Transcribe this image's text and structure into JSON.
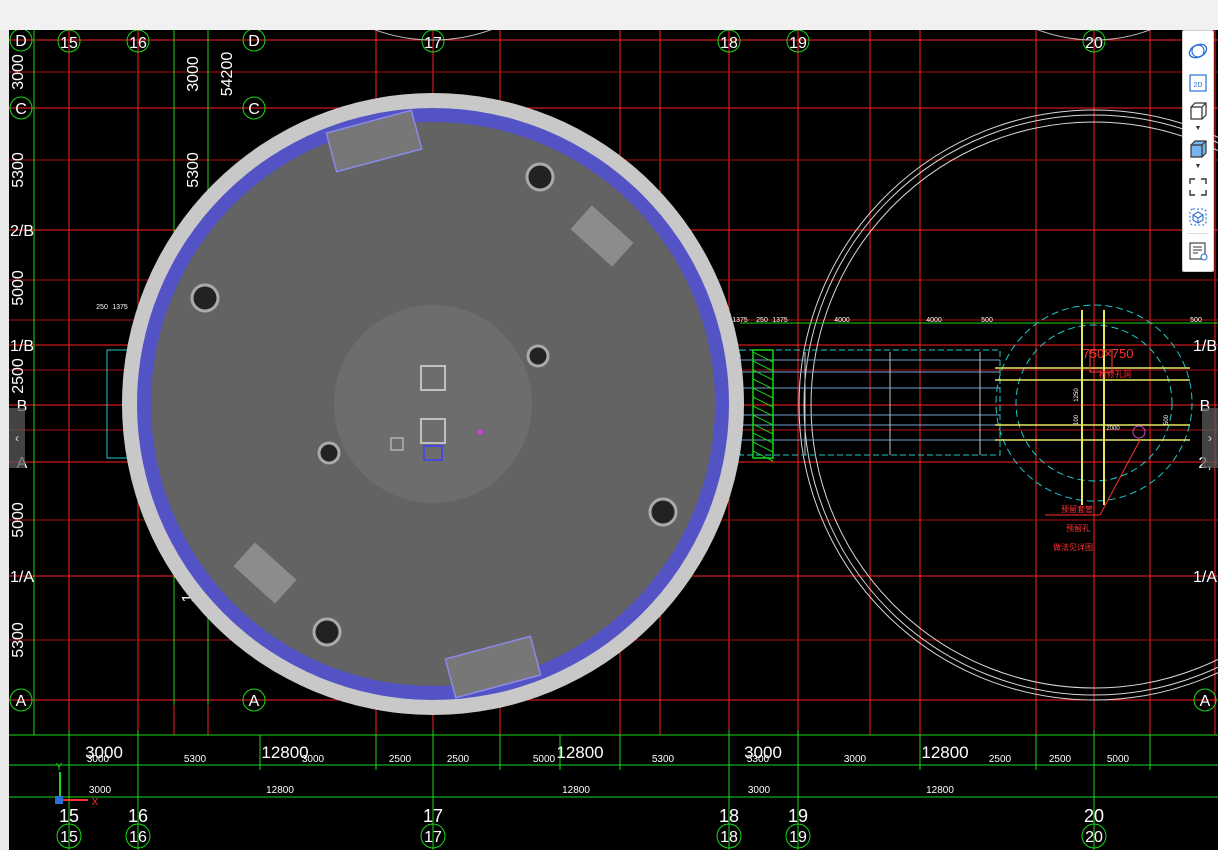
{
  "nav": {
    "prev": "‹",
    "next": "›"
  },
  "toolbar": [
    {
      "name": "orbit-icon",
      "label": "orbit"
    },
    {
      "name": "view-2d-icon",
      "label": "2D"
    },
    {
      "name": "wireframe-cube-icon",
      "label": "wireframe"
    },
    {
      "name": "shaded-cube-icon",
      "label": "shaded"
    },
    {
      "name": "zoom-extents-icon",
      "label": "extents"
    },
    {
      "name": "view-cube-icon",
      "label": "view"
    },
    {
      "name": "layers-list-icon",
      "label": "layers"
    }
  ],
  "grid": {
    "cols": [
      {
        "label": "15"
      },
      {
        "label": "16"
      },
      {
        "label": "17"
      },
      {
        "label": "18"
      },
      {
        "label": "19"
      },
      {
        "label": "20"
      }
    ],
    "rows_left": [
      "D",
      "C",
      "2/B",
      "1/B",
      "B",
      "A",
      "1/A",
      "A"
    ],
    "rows_right": [
      "1/B",
      "B",
      "2,",
      "1/A",
      "A"
    ],
    "inner_row_labels": [
      "D",
      "C",
      "A"
    ],
    "left_dims": [
      "3000",
      "5300",
      "5000",
      "2500",
      "5000",
      "5300"
    ],
    "inner_dims": [
      "3000",
      "5300",
      "54200"
    ],
    "inner_dim_partial": "1"
  },
  "bottom_dims": {
    "row1_big": [
      "3000",
      "12800",
      "12800",
      "3000",
      "12800"
    ],
    "row1_small": [
      "3000",
      "5300",
      "3000",
      "2500",
      "2500",
      "5000",
      "5300",
      "5300",
      "3000",
      "2500",
      "2500",
      "5000"
    ],
    "row2": [
      "3000",
      "12800",
      "12800",
      "3000",
      "12800"
    ]
  },
  "annotations": {
    "small_dims_left": [
      "250",
      "1375"
    ],
    "small_dims_right": [
      "1375",
      "250",
      "1375",
      "4000",
      "4000",
      "500",
      "500"
    ],
    "red_size": "750×750",
    "red_notes": [
      "检修孔洞",
      "预留套管",
      "预留孔",
      "做法见详图"
    ],
    "small_nums": [
      "1250",
      "2000",
      "100",
      "500"
    ]
  },
  "axis_indicator": {
    "x": "X",
    "y": "Y"
  },
  "colors": {
    "grid": "#ff2020",
    "dim": "#19d919",
    "tank_fill": "#636363",
    "tank_ring": "#c8c8c8",
    "tank_band": "#5353c6",
    "cyan": "#20c8c8",
    "yellow": "#e8e860",
    "bg": "#000000"
  }
}
